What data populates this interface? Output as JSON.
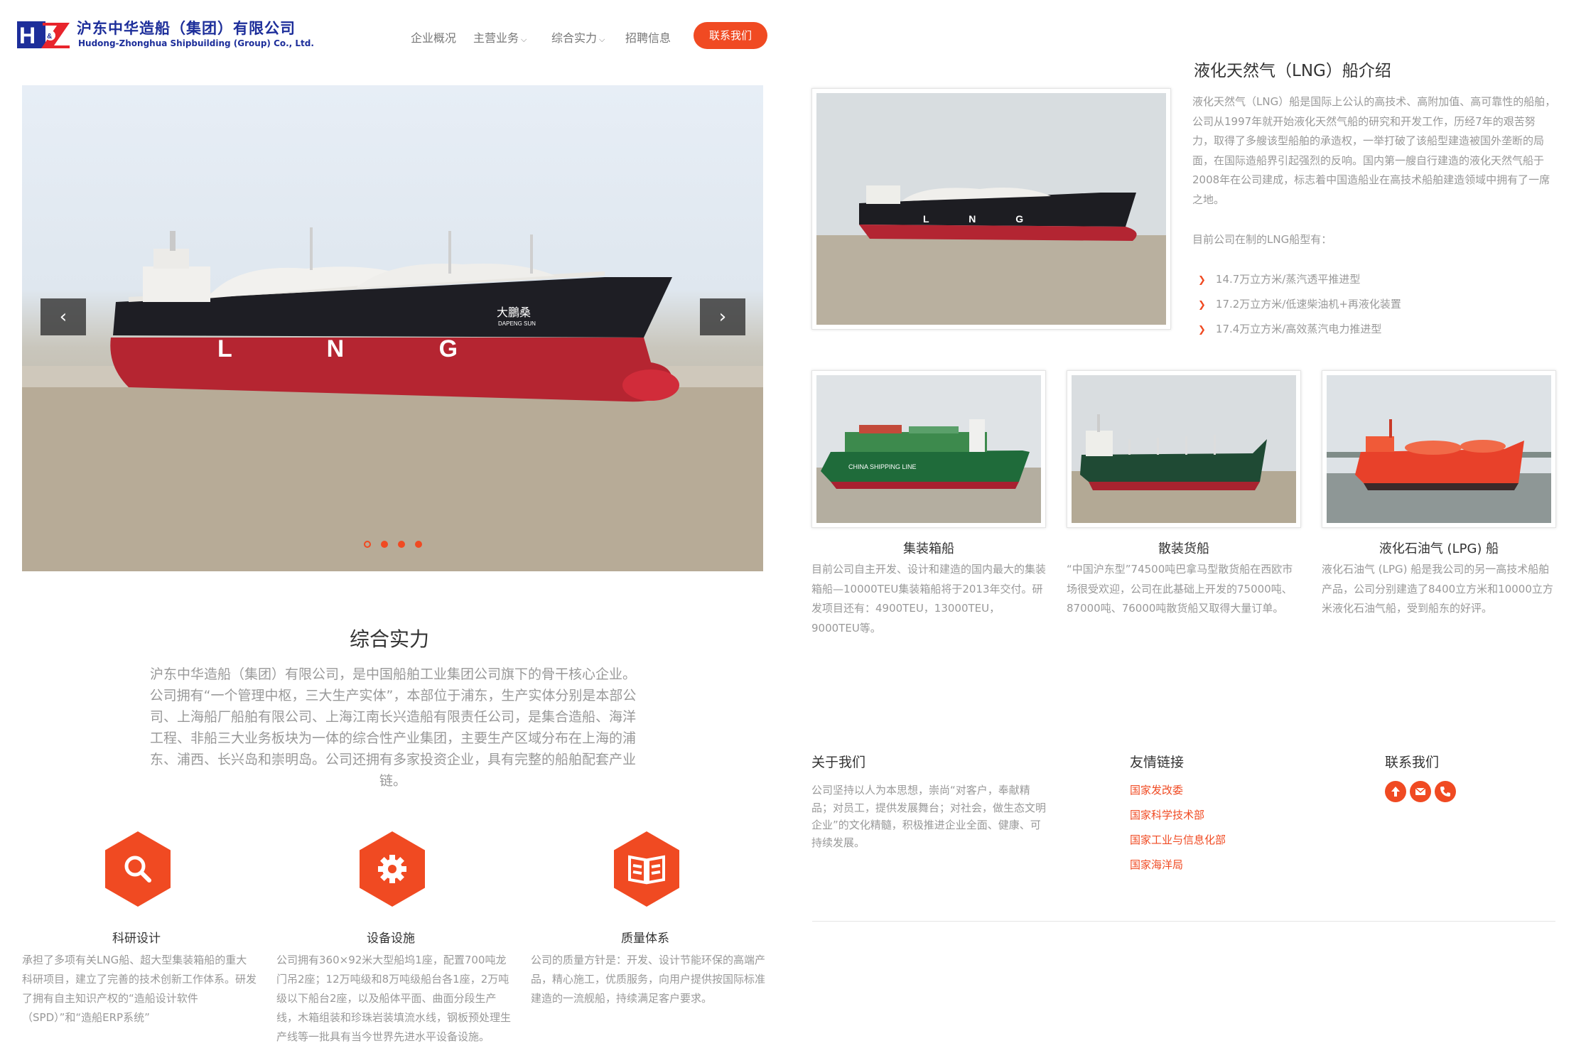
{
  "header": {
    "logo_text_cn": "沪东中华造船（集团）有限公司",
    "logo_text_en": "Hudong-Zhonghua Shipbuilding (Group) Co., Ltd.",
    "logo_mark": "H&Z",
    "nav": [
      "企业概况",
      "主营业务",
      "综合实力",
      "招聘信息"
    ],
    "contact_button": "联系我们",
    "accent_color": "#f04a22",
    "brand_color": "#1d2e9a"
  },
  "slider": {
    "ship_marks": "L N G",
    "ship_name_cn": "大鵬桑",
    "ship_name_en": "DAPENG SUN",
    "prev_icon": "‹",
    "next_icon": "›",
    "slide_count": 4,
    "active_slide": 1
  },
  "strength": {
    "title": "综合实力",
    "text": "沪东中华造船（集团）有限公司，是中国船舶工业集团公司旗下的骨干核心企业。公司拥有“一个管理中枢，三大生产实体”，本部位于浦东，生产实体分别是本部公司、上海船厂船舶有限公司、上海江南长兴造船有限责任公司，是集合造船、海洋工程、非船三大业务板块为一体的综合性产业集团，主要生产区域分布在上海的浦东、浦西、长兴岛和崇明岛。公司还拥有多家投资企业，具有完整的船舶配套产业链。"
  },
  "features": [
    {
      "icon": "search-icon",
      "title": "科研设计",
      "text": "承担了多项有关LNG船、超大型集装箱船的重大科研项目，建立了完善的技术创新工作体系。研发了拥有自主知识产权的“造船设计软件（SPD）”和“造船ERP系统”"
    },
    {
      "icon": "gear-icon",
      "title": "设备设施",
      "text": "公司拥有360×92米大型船坞1座，配置700吨龙门吊2座；12万吨级和8万吨级船台各1座，2万吨级以下船台2座，以及船体平面、曲面分段生产线，木箱组装和珍珠岩装填流水线，钢板预处理生产线等一批具有当今世界先进水平设备设施。"
    },
    {
      "icon": "book-icon",
      "title": "质量体系",
      "text": "公司的质量方针是：开发、设计节能环保的高端产品，精心施工，优质服务，向用户提供按国际标准建造的一流舰船，持续满足客户要求。"
    }
  ],
  "lng": {
    "title": "液化天然气（LNG）船介绍",
    "text": "液化天然气（LNG）船是国际上公认的高技术、高附加值、高可靠性的船舶，公司从1997年就开始液化天然气船的研究和开发工作，历经7年的艰苦努力，取得了多艘该型船舶的承造权，一举打破了该船型建造被国外垄断的局面，在国际造船界引起强烈的反响。国内第一艘自行建造的液化天然气船于2008年在公司建成，标志着中国造船业在高技术船舶建造领域中拥有了一席之地。",
    "subtitle": "目前公司在制的LNG船型有：",
    "bullets": [
      "14.7万立方米/蒸汽透平推进型",
      "17.2万立方米/低速柴油机+再液化装置",
      "17.4万立方米/高效蒸汽电力推进型"
    ]
  },
  "ships": [
    {
      "name": "集装箱船",
      "hull_text": "CHINA SHIPPING LINE",
      "text": "目前公司自主开发、设计和建造的国内最大的集装箱船—10000TEU集装箱船将于2013年交付。研发项目还有：4900TEU，13000TEU，9000TEU等。"
    },
    {
      "name": "散装货船",
      "hull_text": "",
      "text": "“中国沪东型”74500吨巴拿马型散货船在西欧市场很受欢迎，公司在此基础上开发的75000吨、87000吨、76000吨散货船又取得大量订单。"
    },
    {
      "name": "液化石油气 (LPG) 船",
      "hull_text": "",
      "text": "液化石油气 (LPG) 船是我公司的另一高技术船舶产品，公司分别建造了8400立方米和10000立方米液化石油气船，受到船东的好评。"
    }
  ],
  "footer": {
    "about_title": "关于我们",
    "about_text": "公司坚持以人为本思想，崇尚“对客户，奉献精品；对员工，提供发展舞台；对社会，做生态文明企业”的文化精髓，积极推进企业全面、健康、可持续发展。",
    "links_title": "友情链接",
    "links": [
      "国家发改委",
      "国家科学技术部",
      "国家工业与信息化部",
      "国家海洋局"
    ],
    "contact_title": "联系我们",
    "contact_icons": [
      "upload-icon",
      "mail-icon",
      "phone-icon"
    ]
  }
}
